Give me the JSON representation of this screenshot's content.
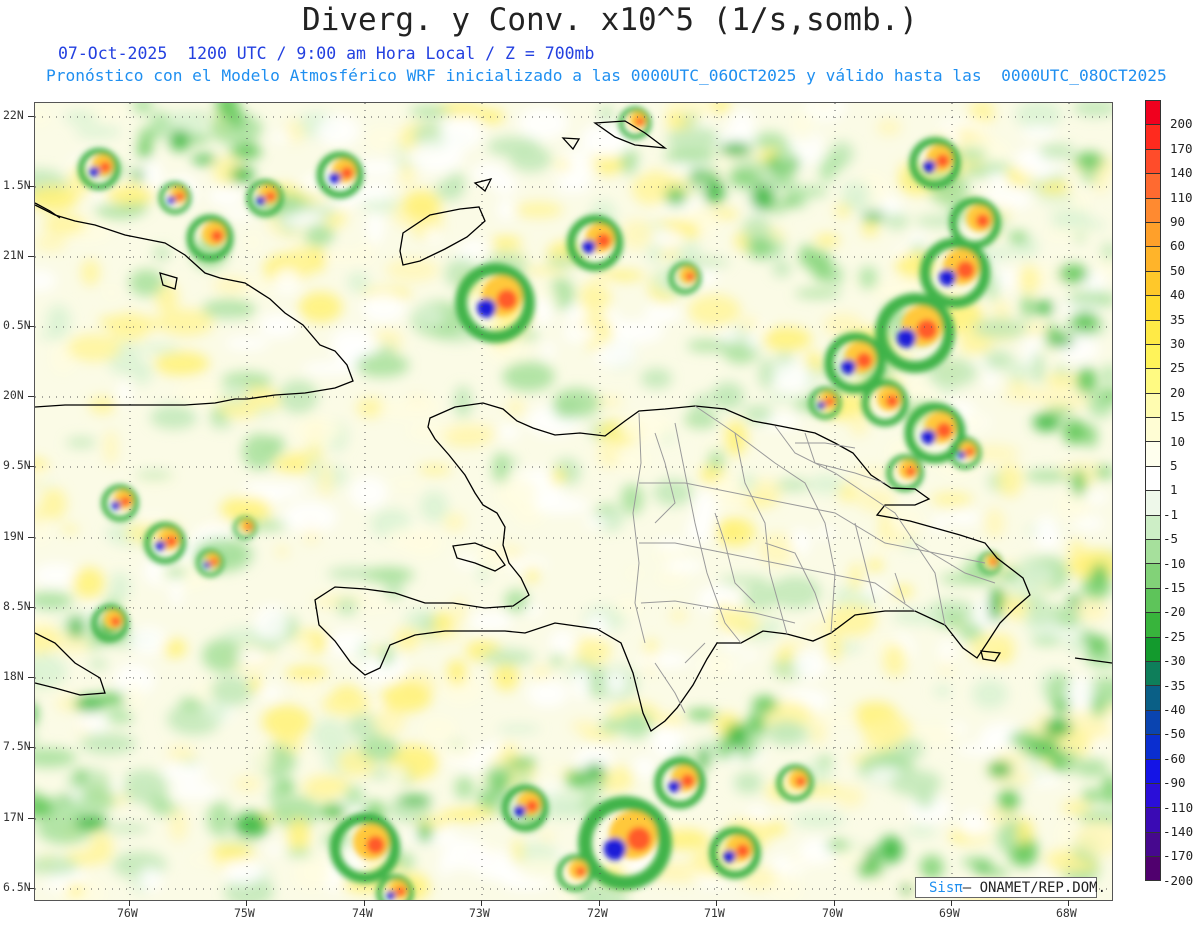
{
  "header": {
    "title": "Diverg. y Conv. x10^5 (1/s,somb.)",
    "subtitle_time": "07-Oct-2025  1200 UTC / 9:00 am Hora Local / Z = 700mb",
    "subtitle_model": "Pronóstico con el Modelo Atmosférico WRF inicializado a las 0000UTC_06OCT2025 y válido hasta las  0000UTC_08OCT2025"
  },
  "map": {
    "lat_labels": [
      "22N",
      "1.5N",
      "21N",
      "0.5N",
      "20N",
      "9.5N",
      "19N",
      "8.5N",
      "18N",
      "7.5N",
      "17N",
      "6.5N"
    ],
    "lon_labels": [
      "76W",
      "75W",
      "74W",
      "73W",
      "72W",
      "71W",
      "70W",
      "69W",
      "68W"
    ],
    "lat_range": [
      16.5,
      22.0
    ],
    "lon_range": [
      -76.8,
      -67.7
    ],
    "gridlines": "dotted",
    "features": [
      "coastlines",
      "provincial-boundaries"
    ]
  },
  "colorbar": {
    "labels": [
      "200",
      "170",
      "140",
      "110",
      "90",
      "60",
      "50",
      "40",
      "35",
      "30",
      "25",
      "20",
      "15",
      "10",
      "5",
      "1",
      "-1",
      "-5",
      "-10",
      "-15",
      "-20",
      "-25",
      "-30",
      "-35",
      "-40",
      "-50",
      "-60",
      "-90",
      "-110",
      "-140",
      "-170",
      "-200"
    ],
    "colors": [
      "#f0001e",
      "#ff2a1e",
      "#ff4c2a",
      "#ff6a30",
      "#ff8a30",
      "#ffa02a",
      "#ffb42a",
      "#ffc82a",
      "#ffdc30",
      "#ffea46",
      "#fff35a",
      "#fffa82",
      "#fffcb0",
      "#fffdd4",
      "#ffffee",
      "#ffffff",
      "#eef8ea",
      "#cdeec6",
      "#a6e09c",
      "#82d278",
      "#5ec45a",
      "#38b43c",
      "#139a2d",
      "#0e7e5a",
      "#0a5f86",
      "#0a44b0",
      "#0a2ed0",
      "#1414e6",
      "#2a0ed8",
      "#3a0ab4",
      "#46088e",
      "#50006e"
    ]
  },
  "credit": {
    "brand": "Sisπ",
    "text": "– ONAMET/REP.DOM."
  }
}
